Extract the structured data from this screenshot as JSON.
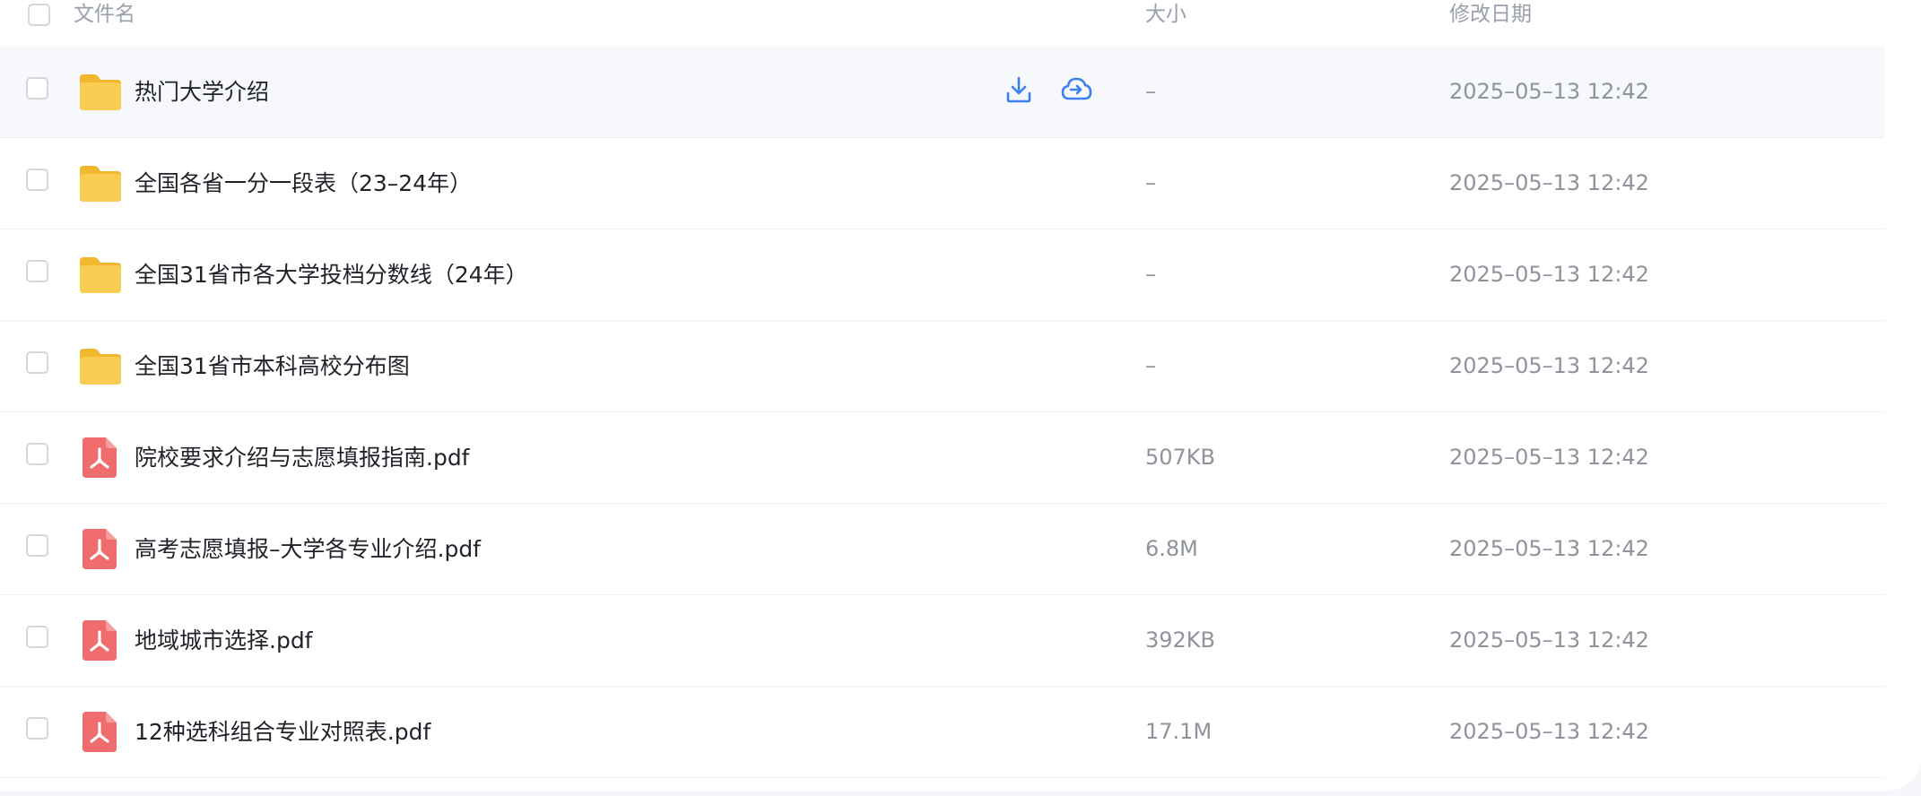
{
  "header": {
    "col_name": "文件名",
    "col_size": "大小",
    "col_modified": "修改日期"
  },
  "colors": {
    "folder": "#f8cd51",
    "pdf": "#ef6d6d",
    "action_icon": "#3b7ff0",
    "hover_row": "#f6f8fb"
  },
  "files": [
    {
      "type": "folder",
      "icon": "folder-icon",
      "name": "热门大学介绍",
      "size": "–",
      "modified": "2025–05–13 12:42",
      "hovered": true
    },
    {
      "type": "folder",
      "icon": "folder-icon",
      "name": "全国各省一分一段表（23–24年）",
      "size": "–",
      "modified": "2025–05–13 12:42"
    },
    {
      "type": "folder",
      "icon": "folder-icon",
      "name": "全国31省市各大学投档分数线（24年）",
      "size": "–",
      "modified": "2025–05–13 12:42"
    },
    {
      "type": "folder",
      "icon": "folder-icon",
      "name": "全国31省市本科高校分布图",
      "size": "–",
      "modified": "2025–05–13 12:42"
    },
    {
      "type": "pdf",
      "icon": "pdf-file-icon",
      "name": "院校要求介绍与志愿填报指南.pdf",
      "size": "507KB",
      "modified": "2025–05–13 12:42"
    },
    {
      "type": "pdf",
      "icon": "pdf-file-icon",
      "name": "高考志愿填报–大学各专业介绍.pdf",
      "size": "6.8M",
      "modified": "2025–05–13 12:42"
    },
    {
      "type": "pdf",
      "icon": "pdf-file-icon",
      "name": "地域城市选择.pdf",
      "size": "392KB",
      "modified": "2025–05–13 12:42"
    },
    {
      "type": "pdf",
      "icon": "pdf-file-icon",
      "name": "12种选科组合专业对照表.pdf",
      "size": "17.1M",
      "modified": "2025–05–13 12:42"
    }
  ],
  "row_actions": {
    "download_icon": "download-icon",
    "save_to_cloud_icon": "cloud-save-icon"
  }
}
